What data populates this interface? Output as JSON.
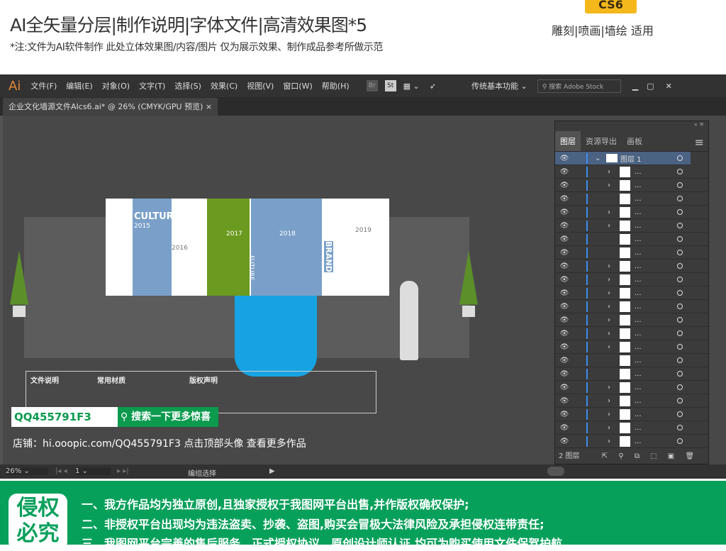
{
  "header": {
    "title": "AI全矢量分层|制作说明|字体文件|高清效果图*5",
    "subtitle": "*注:文件为AI软件制作 此处立体效果图/内容/图片 仅为展示效果、制作成品参考所做示范",
    "badge": "CS6",
    "usage": "雕刻|喷画|墙绘 适用"
  },
  "app": {
    "logo": "Ai",
    "menu": [
      "文件(F)",
      "编辑(E)",
      "对象(O)",
      "文字(T)",
      "选择(S)",
      "效果(C)",
      "视图(V)",
      "窗口(W)",
      "帮助(H)"
    ],
    "br": "Br",
    "st": "St",
    "workspace": "传统基本功能",
    "search_placeholder": "搜索 Adobe Stock",
    "doc_tab": "企业文化墙源文件AIcs6.ai* @ 26% (CMYK/GPU 预览)"
  },
  "artwork": {
    "texts": [
      "CULTURE",
      "2015",
      "2016",
      "2017",
      "FUTURE",
      "2018",
      "BRAND",
      "2019"
    ],
    "notes": [
      "文件说明",
      "常用材质",
      "版权声明"
    ]
  },
  "promo": {
    "qq": "QQ455791F3",
    "search_btn": "搜索一下更多惊喜",
    "shop": "店铺：hi.ooopic.com/QQ455791F3  点击顶部头像 查看更多作品"
  },
  "layers_panel": {
    "tabs": [
      "图层",
      "资源导出",
      "画板"
    ],
    "top_layer": "图层 1",
    "sublayer_label": "...",
    "count_label": "2 图层",
    "rows_chevron": [
      1,
      1,
      0,
      1,
      1,
      0,
      0,
      1,
      1,
      1,
      1,
      1,
      1,
      1,
      0,
      0,
      1,
      1,
      1,
      1,
      1
    ]
  },
  "status": {
    "zoom": "26%",
    "page": "1",
    "tool": "编组选择"
  },
  "colors": {
    "accent_green": "#07a05b",
    "ai_orange": "#e3883a",
    "wall_blue": "#7aa0c9",
    "wall_green": "#6a9a1f"
  },
  "footer": {
    "stamp": "侵权必究",
    "lines": [
      "一、我方作品均为独立原创,且独家授权于我图网平台出售,并作版权确权保护;",
      "二、非授权平台出现均为违法盗卖、抄袭、盗图,购买会冒极大法律风险及承担侵权连带责任;",
      "三、我图网平台完善的售后服务、正式授权协议、原创设计师认证,均可为购买使用文件保驾护航。"
    ]
  }
}
